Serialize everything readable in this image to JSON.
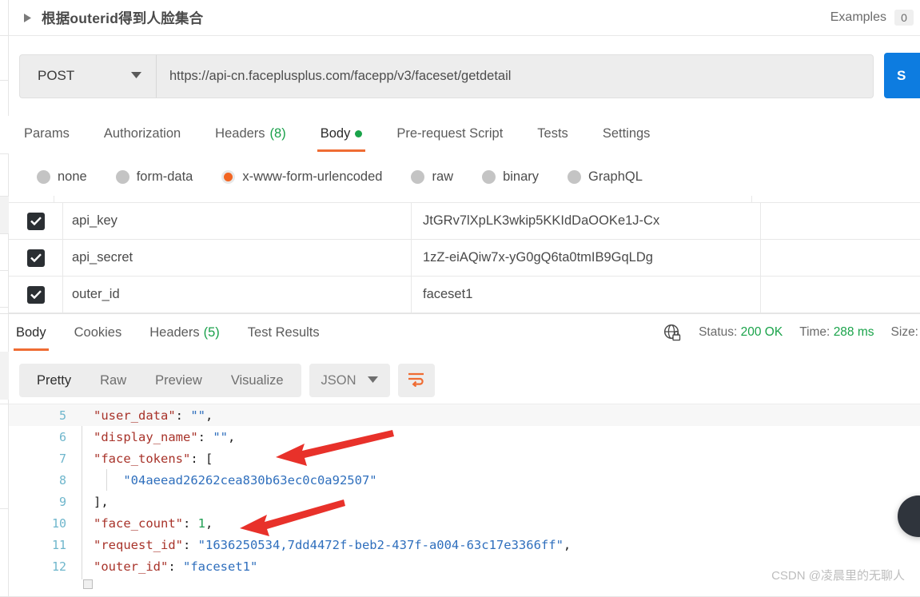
{
  "request": {
    "title": "根据outerid得到人脸集合",
    "caret_icon": "triangle-right-icon",
    "examples_label": "Examples",
    "examples_count": "0",
    "method": "POST",
    "method_caret_icon": "chevron-down-icon",
    "url": "https://api-cn.faceplusplus.com/facepp/v3/faceset/getdetail",
    "send_label": "S",
    "tabs": [
      {
        "label": "Params",
        "count": "",
        "active": false,
        "dot": false
      },
      {
        "label": "Authorization",
        "count": "",
        "active": false,
        "dot": false
      },
      {
        "label": "Headers",
        "count": "(8)",
        "active": false,
        "dot": false
      },
      {
        "label": "Body",
        "count": "",
        "active": true,
        "dot": true
      },
      {
        "label": "Pre-request Script",
        "count": "",
        "active": false,
        "dot": false
      },
      {
        "label": "Tests",
        "count": "",
        "active": false,
        "dot": false
      },
      {
        "label": "Settings",
        "count": "",
        "active": false,
        "dot": false
      }
    ],
    "body_modes": [
      {
        "label": "none",
        "selected": false
      },
      {
        "label": "form-data",
        "selected": false
      },
      {
        "label": "x-www-form-urlencoded",
        "selected": true
      },
      {
        "label": "raw",
        "selected": false
      },
      {
        "label": "binary",
        "selected": false
      },
      {
        "label": "GraphQL",
        "selected": false
      }
    ],
    "params": [
      {
        "checked": true,
        "key": "api_key",
        "value": "JtGRv7lXpLK3wkip5KKIdDaOOKe1J-Cx"
      },
      {
        "checked": true,
        "key": "api_secret",
        "value": "1zZ-eiAQiw7x-yG0gQ6ta0tmIB9GqLDg"
      },
      {
        "checked": true,
        "key": "outer_id",
        "value": "faceset1"
      }
    ]
  },
  "response": {
    "tabs": [
      {
        "label": "Body",
        "count": "",
        "active": true
      },
      {
        "label": "Cookies",
        "count": "",
        "active": false
      },
      {
        "label": "Headers",
        "count": "(5)",
        "active": false
      },
      {
        "label": "Test Results",
        "count": "",
        "active": false
      }
    ],
    "secure_icon": "globe-lock-icon",
    "status_label": "Status:",
    "status_value": "200 OK",
    "time_label": "Time:",
    "time_value": "288 ms",
    "size_label": "Size:",
    "view_modes": [
      {
        "label": "Pretty",
        "active": true
      },
      {
        "label": "Raw",
        "active": false
      },
      {
        "label": "Preview",
        "active": false
      },
      {
        "label": "Visualize",
        "active": false
      }
    ],
    "format": "JSON",
    "format_caret_icon": "chevron-down-icon",
    "wrap_icon": "wrap-lines-icon",
    "code_lines": [
      {
        "num": "5",
        "highlight": true,
        "indent_guide": false,
        "tokens": [
          {
            "t": "key",
            "v": "\"user_data\""
          },
          {
            "t": "pun",
            "v": ": "
          },
          {
            "t": "str",
            "v": "\"\""
          },
          {
            "t": "pun",
            "v": ","
          }
        ]
      },
      {
        "num": "6",
        "highlight": false,
        "indent_guide": false,
        "tokens": [
          {
            "t": "key",
            "v": "\"display_name\""
          },
          {
            "t": "pun",
            "v": ": "
          },
          {
            "t": "str",
            "v": "\"\""
          },
          {
            "t": "pun",
            "v": ","
          }
        ]
      },
      {
        "num": "7",
        "highlight": false,
        "indent_guide": false,
        "tokens": [
          {
            "t": "key",
            "v": "\"face_tokens\""
          },
          {
            "t": "pun",
            "v": ": ["
          }
        ]
      },
      {
        "num": "8",
        "highlight": false,
        "indent_guide": true,
        "tokens": [
          {
            "t": "str",
            "v": "    \"04aeead26262cea830b63ec0c0a92507\""
          }
        ]
      },
      {
        "num": "9",
        "highlight": false,
        "indent_guide": false,
        "tokens": [
          {
            "t": "pun",
            "v": "],"
          }
        ]
      },
      {
        "num": "10",
        "highlight": false,
        "indent_guide": false,
        "tokens": [
          {
            "t": "key",
            "v": "\"face_count\""
          },
          {
            "t": "pun",
            "v": ": "
          },
          {
            "t": "num",
            "v": "1"
          },
          {
            "t": "pun",
            "v": ","
          }
        ]
      },
      {
        "num": "11",
        "highlight": false,
        "indent_guide": false,
        "tokens": [
          {
            "t": "key",
            "v": "\"request_id\""
          },
          {
            "t": "pun",
            "v": ": "
          },
          {
            "t": "str",
            "v": "\"1636250534,7dd4472f-beb2-437f-a004-63c17e3366ff\""
          },
          {
            "t": "pun",
            "v": ","
          }
        ]
      },
      {
        "num": "12",
        "highlight": false,
        "indent_guide": false,
        "tokens": [
          {
            "t": "key",
            "v": "\"outer_id\""
          },
          {
            "t": "pun",
            "v": ": "
          },
          {
            "t": "str",
            "v": "\"faceset1\""
          }
        ]
      }
    ]
  },
  "annotations": {
    "arrow_color": "#e8312a",
    "arrows": [
      {
        "name": "arrow-face-tokens"
      },
      {
        "name": "arrow-face-count"
      }
    ]
  },
  "watermark": "CSDN @凌晨里的无聊人",
  "colors": {
    "accent_orange": "#ef6c33",
    "send_blue": "#0d7ce0",
    "status_green": "#1aa34a",
    "radio_orange": "#f26522"
  }
}
